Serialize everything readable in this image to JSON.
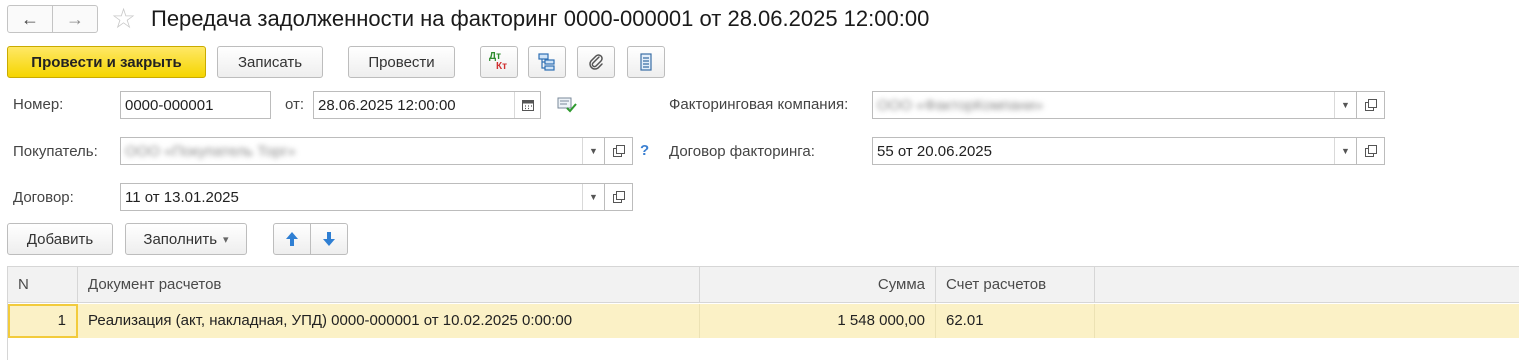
{
  "window": {
    "title": "Передача задолженности на факторинг 0000-000001 от 28.06.2025 12:00:00",
    "back_icon": "arrow-left-icon",
    "forward_icon": "arrow-right-icon",
    "favorite_icon": "star-icon"
  },
  "toolbar": {
    "post_and_close": "Провести и закрыть",
    "save": "Записать",
    "post": "Провести",
    "dt_kt_top": "Дт",
    "dt_kt_bottom": "Кт",
    "icons": [
      "dt-kt-icon",
      "structure-icon",
      "paperclip-icon",
      "report-list-icon"
    ]
  },
  "form": {
    "number_label": "Номер:",
    "number_value": "0000-000001",
    "from_label": "от:",
    "date_value": "28.06.2025 12:00:00",
    "factoring_company_label": "Факторинговая компания:",
    "factoring_company_value": "ООО «ФакторКомпани»",
    "buyer_label": "Покупатель:",
    "buyer_value": "ООО «Покупатель Торг»",
    "buyer_help": "?",
    "factoring_contract_label": "Договор факторинга:",
    "factoring_contract_value": "55 от 20.06.2025",
    "contract_label": "Договор:",
    "contract_value": "11 от 13.01.2025"
  },
  "table_toolbar": {
    "add": "Добавить",
    "fill": "Заполнить",
    "fill_arrow": "▾"
  },
  "table": {
    "columns": [
      "N",
      "Документ расчетов",
      "Сумма",
      "Счет расчетов"
    ],
    "rows": [
      {
        "n": "1",
        "document": "Реализация (акт, накладная, УПД) 0000-000001 от 10.02.2025 0:00:00",
        "amount": "1 548 000,00",
        "account": "62.01"
      }
    ]
  },
  "colors": {
    "primary_button": "#f5d500",
    "selected_row": "#fbf1c6",
    "selected_cell_border": "#f2cb3c",
    "arrow_blue": "#2f7fd3",
    "help_blue": "#3a7fd1"
  }
}
